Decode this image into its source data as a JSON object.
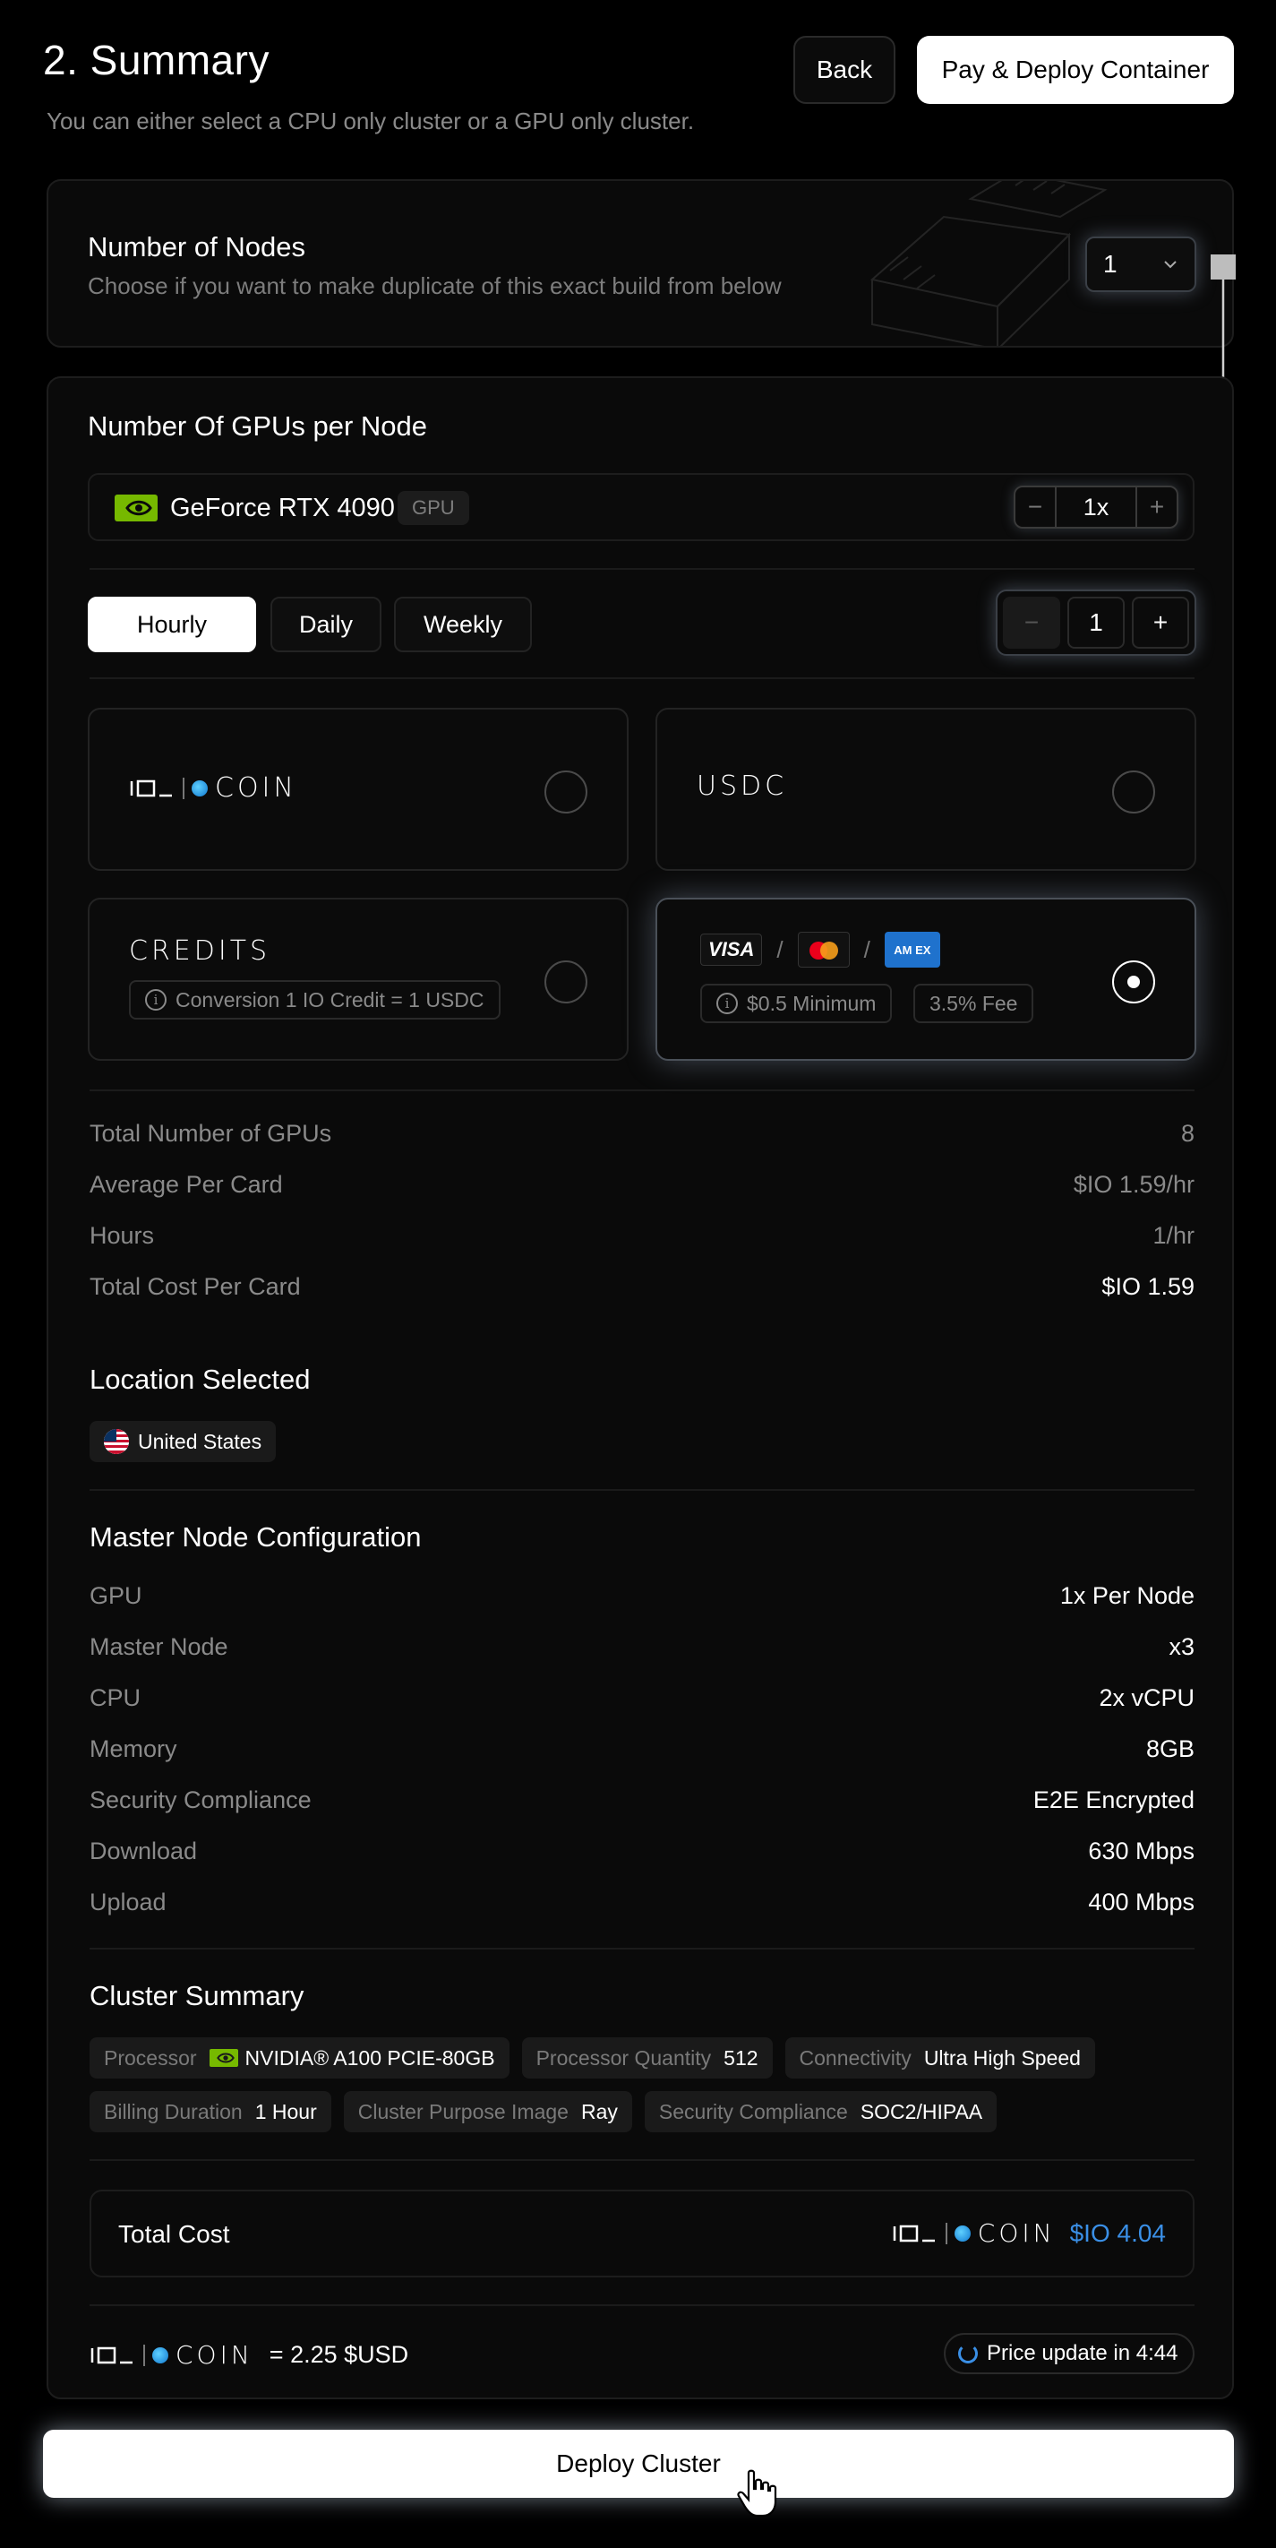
{
  "header": {
    "title": "2. Summary",
    "subtitle": "You can either select a CPU only cluster or a GPU only cluster.",
    "back_label": "Back",
    "pay_label": "Pay & Deploy Container"
  },
  "nodes": {
    "title": "Number of Nodes",
    "description": "Choose if you want to make duplicate of this exact build from below",
    "selected": "1"
  },
  "gpus": {
    "title": "Number Of GPUs per Node",
    "gpu_name": "GeForce RTX 4090",
    "gpu_tag": "GPU",
    "per_node_value": "1x"
  },
  "billing": {
    "tabs": [
      "Hourly",
      "Daily",
      "Weekly"
    ],
    "active_tab": "Hourly",
    "quantity": "1"
  },
  "payment": {
    "io_coin_label": "COIN",
    "usdc_label": "USDC",
    "credits_label": "CREDITS",
    "credits_note": "Conversion 1 IO Credit = 1 USDC",
    "card_minimum": "$0.5 Minimum",
    "card_fee": "3.5% Fee",
    "visa": "VISA",
    "amex": "AM EX",
    "selected": "card"
  },
  "costs": [
    {
      "label": "Total Number of GPUs",
      "value": "8"
    },
    {
      "label": "Average Per Card",
      "value": "$IO 1.59/hr"
    },
    {
      "label": "Hours",
      "value": "1/hr"
    },
    {
      "label": "Total Cost Per Card",
      "value": "$IO 1.59"
    }
  ],
  "location": {
    "title": "Location Selected",
    "country": "United States"
  },
  "master": {
    "title": "Master Node Configuration",
    "rows": [
      {
        "label": "GPU",
        "value": "1x Per Node"
      },
      {
        "label": "Master Node",
        "value": "x3"
      },
      {
        "label": "CPU",
        "value": "2x vCPU"
      },
      {
        "label": "Memory",
        "value": "8GB"
      },
      {
        "label": "Security Compliance",
        "value": "E2E Encrypted"
      },
      {
        "label": "Download",
        "value": "630 Mbps"
      },
      {
        "label": "Upload",
        "value": "400 Mbps"
      }
    ]
  },
  "cluster": {
    "title": "Cluster Summary",
    "tags": [
      {
        "key": "Processor",
        "value": "NVIDIA® A100 PCIE-80GB"
      },
      {
        "key": "Processor Quantity",
        "value": "512"
      },
      {
        "key": "Connectivity",
        "value": "Ultra High Speed"
      },
      {
        "key": "Billing Duration",
        "value": "1 Hour"
      },
      {
        "key": "Cluster Purpose Image",
        "value": "Ray"
      },
      {
        "key": "Security Compliance",
        "value": "SOC2/HIPAA"
      }
    ]
  },
  "total": {
    "label": "Total Cost",
    "coin_label": "COIN",
    "amount": "$IO 4.04"
  },
  "rate": {
    "coin_label": "COIN",
    "text": "= 2.25 $USD",
    "price_update": "Price update in 4:44"
  },
  "deploy_label": "Deploy Cluster",
  "colors": {
    "accent_blue": "#3a8fe6",
    "nvidia_green": "#76b900",
    "amex_blue": "#1f72cd"
  }
}
